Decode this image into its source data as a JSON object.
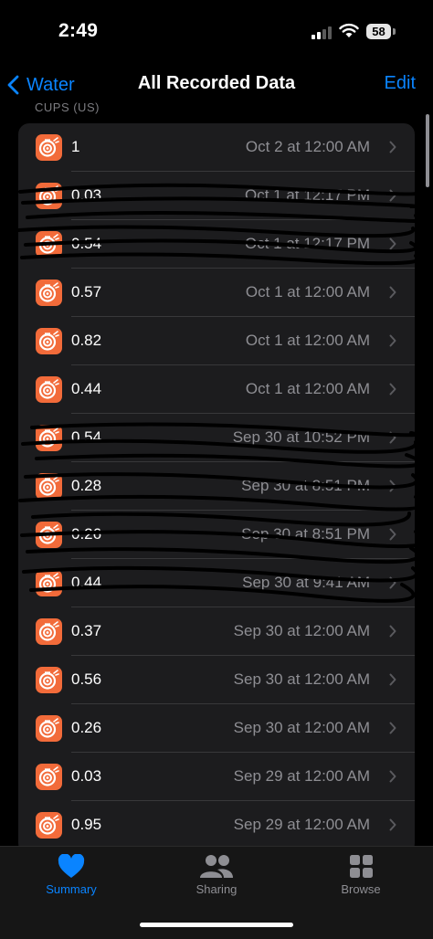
{
  "status_bar": {
    "time": "2:49",
    "battery": "58"
  },
  "nav": {
    "back_label": "Water",
    "title": "All Recorded Data",
    "edit_label": "Edit"
  },
  "section_header": "CUPS (US)",
  "rows": [
    {
      "value": "1",
      "date": "Oct 2 at 12:00 AM"
    },
    {
      "value": "0.03",
      "date": "Oct 1 at 12:17 PM"
    },
    {
      "value": "0.54",
      "date": "Oct 1 at 12:17 PM"
    },
    {
      "value": "0.57",
      "date": "Oct 1 at 12:00 AM"
    },
    {
      "value": "0.82",
      "date": "Oct 1 at 12:00 AM"
    },
    {
      "value": "0.44",
      "date": "Oct 1 at 12:00 AM"
    },
    {
      "value": "0.54",
      "date": "Sep 30 at 10:52 PM"
    },
    {
      "value": "0.28",
      "date": "Sep 30 at 8:51 PM"
    },
    {
      "value": "0.26",
      "date": "Sep 30 at 8:51 PM"
    },
    {
      "value": "0.44",
      "date": "Sep 30 at 9:41 AM"
    },
    {
      "value": "0.37",
      "date": "Sep 30 at 12:00 AM"
    },
    {
      "value": "0.56",
      "date": "Sep 30 at 12:00 AM"
    },
    {
      "value": "0.26",
      "date": "Sep 30 at 12:00 AM"
    },
    {
      "value": "0.03",
      "date": "Sep 29 at 12:00 AM"
    },
    {
      "value": "0.95",
      "date": "Sep 29 at 12:00 AM"
    }
  ],
  "tabs": [
    {
      "label": "Summary",
      "icon": "heart-icon"
    },
    {
      "label": "Sharing",
      "icon": "people-icon"
    },
    {
      "label": "Browse",
      "icon": "grid-icon"
    }
  ],
  "colors": {
    "accent": "#0a84ff",
    "row_icon": "#f26b3a",
    "row_bg": "#1c1c1e"
  }
}
